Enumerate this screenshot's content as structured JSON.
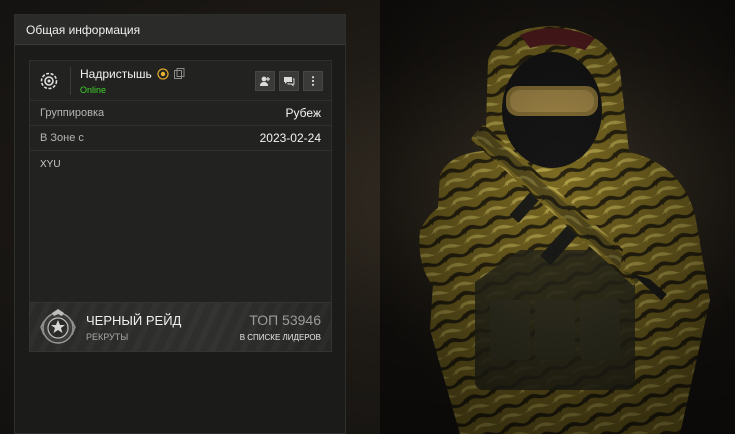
{
  "panel": {
    "title": "Общая информация"
  },
  "player": {
    "name": "Надристышь",
    "status": "Online",
    "avatar_icon": "settings-gear-icon",
    "badge_icon": "achievement-badge-icon",
    "copy_icon": "copy-icon"
  },
  "actions": [
    {
      "name": "add-friend-button",
      "icon": "add-user-icon"
    },
    {
      "name": "message-button",
      "icon": "chat-icon"
    },
    {
      "name": "more-options-button",
      "icon": "more-vertical-icon"
    }
  ],
  "info": {
    "faction_label": "Группировка",
    "faction_value": "Рубеж",
    "zone_label": "В Зоне с",
    "zone_value": "2023-02-24"
  },
  "bio": "XYU",
  "clan": {
    "name": "ЧЕРНЫЙ РЕЙД",
    "rank": "РЕКРУТЫ",
    "top_label": "ТОП 53946",
    "top_sub": "В СПИСКЕ ЛИДЕРОВ",
    "emblem_icon": "clan-emblem-icon"
  },
  "colors": {
    "online": "#3fd22b",
    "panel_bg": "#1b1b1a",
    "header_bg": "#2b2b29",
    "camo": "#8d7a2a"
  }
}
